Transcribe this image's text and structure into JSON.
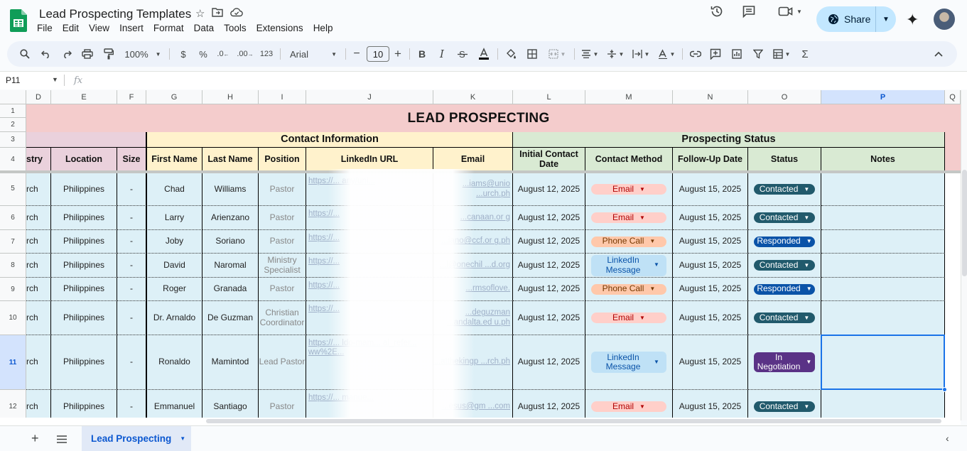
{
  "doc": {
    "title": "Lead Prospecting Templates",
    "menu": [
      "File",
      "Edit",
      "View",
      "Insert",
      "Format",
      "Data",
      "Tools",
      "Extensions",
      "Help"
    ],
    "share_label": "Share"
  },
  "toolbar": {
    "zoom": "100%",
    "currency": "$",
    "percent": "%",
    "dec_decrease": ".0",
    "dec_increase": ".00",
    "number_format": "123",
    "font": "Arial",
    "font_size": "10",
    "minus": "−",
    "plus": "+",
    "bold": "B",
    "italic": "I"
  },
  "formula": {
    "name_box": "P11",
    "fx": "fx"
  },
  "columns": [
    "D",
    "E",
    "F",
    "G",
    "H",
    "I",
    "J",
    "K",
    "L",
    "M",
    "N",
    "O",
    "P",
    "Q"
  ],
  "row_numbers": [
    "1",
    "2",
    "3",
    "4",
    "5",
    "6",
    "7",
    "8",
    "9",
    "10",
    "11",
    "12"
  ],
  "sheet": {
    "title": "LEAD PROSPECTING",
    "group_contact": "Contact Information",
    "group_status": "Prospecting Status",
    "headers": {
      "industry": "stry",
      "location": "Location",
      "size": "Size",
      "first_name": "First Name",
      "last_name": "Last Name",
      "position": "Position",
      "linkedin": "LinkedIn URL",
      "email": "Email",
      "initial_contact": "Initial Contact Date",
      "contact_method": "Contact Method",
      "follow_up": "Follow-Up Date",
      "status": "Status",
      "notes": "Notes"
    },
    "rows": [
      {
        "industry": "rch",
        "location": "Philippines",
        "size": "-",
        "first": "Chad",
        "last": "Williams",
        "position": "Pastor",
        "linkedin": "https://... any/uni...",
        "email": "...iams@unio ...urch.ph",
        "initial": "August 12, 2025",
        "method": "Email",
        "followup": "August 15, 2025",
        "status": "Contacted"
      },
      {
        "industry": "rch",
        "location": "Philippines",
        "size": "-",
        "first": "Larry",
        "last": "Arienzano",
        "position": "Pastor",
        "linkedin": "https://...",
        "email": "...canaan.or g",
        "initial": "August 12, 2025",
        "method": "Email",
        "followup": "August 15, 2025",
        "status": "Contacted"
      },
      {
        "industry": "rch",
        "location": "Philippines",
        "size": "-",
        "first": "Joby",
        "last": "Soriano",
        "position": "Pastor",
        "linkedin": "https://...",
        "email": "...iano@ccf.or g.ph",
        "initial": "August 12, 2025",
        "method": "Phone Call",
        "followup": "August 15, 2025",
        "status": "Responded"
      },
      {
        "industry": "rch",
        "location": "Philippines",
        "size": "-",
        "first": "David",
        "last": "Naromal",
        "position": "Ministry Specialist",
        "linkedin": "https://...",
        "email": "...l@onechil ...d.org",
        "initial": "August 12, 2025",
        "method": "LinkedIn Message",
        "followup": "August 15, 2025",
        "status": "Contacted"
      },
      {
        "industry": "rch",
        "location": "Philippines",
        "size": "-",
        "first": "Roger",
        "last": "Granada",
        "position": "Pastor",
        "linkedin": "https://...",
        "email": "...rmsoflove.",
        "initial": "August 12, 2025",
        "method": "Phone Call",
        "followup": "August 15, 2025",
        "status": "Responded"
      },
      {
        "industry": "rch",
        "location": "Philippines",
        "size": "-",
        "first": "Dr. Arnaldo",
        "last": "De Guzman",
        "position": "Christian Coordinator",
        "linkedin": "https://...",
        "email": "...deguzman ...andalta.ed u.ph",
        "initial": "August 12, 2025",
        "method": "Email",
        "followup": "August 15, 2025",
        "status": "Contacted"
      },
      {
        "industry": "rch",
        "location": "Philippines",
        "size": "-",
        "first": "Ronaldo",
        "last": "Mamintod",
        "position": "Lead Pastor",
        "linkedin": "https://... ldo-mam... al_refer... ww%2E...",
        "email": "...atthekingp ...rch.ph",
        "initial": "August 12, 2025",
        "method": "LinkedIn Message",
        "followup": "August 15, 2025",
        "status": "In Negotiation"
      },
      {
        "industry": "rch",
        "location": "Philippines",
        "size": "-",
        "first": "Emmanuel",
        "last": "Santiago",
        "position": "Pastor",
        "linkedin": "https://... manue...",
        "email": "...esus@gm ...com",
        "initial": "August 12, 2025",
        "method": "Email",
        "followup": "August 15, 2025",
        "status": "Contacted"
      }
    ]
  },
  "sheet_tabs": [
    {
      "label": "Lead Prospecting"
    }
  ],
  "colors": {
    "title_band": "#f4cccc",
    "pink_band": "#ead1dc",
    "contact_band": "#fff2cc",
    "status_band": "#d9ead3",
    "data_fill": "#ddf0f7",
    "accent": "#0b57d0"
  }
}
